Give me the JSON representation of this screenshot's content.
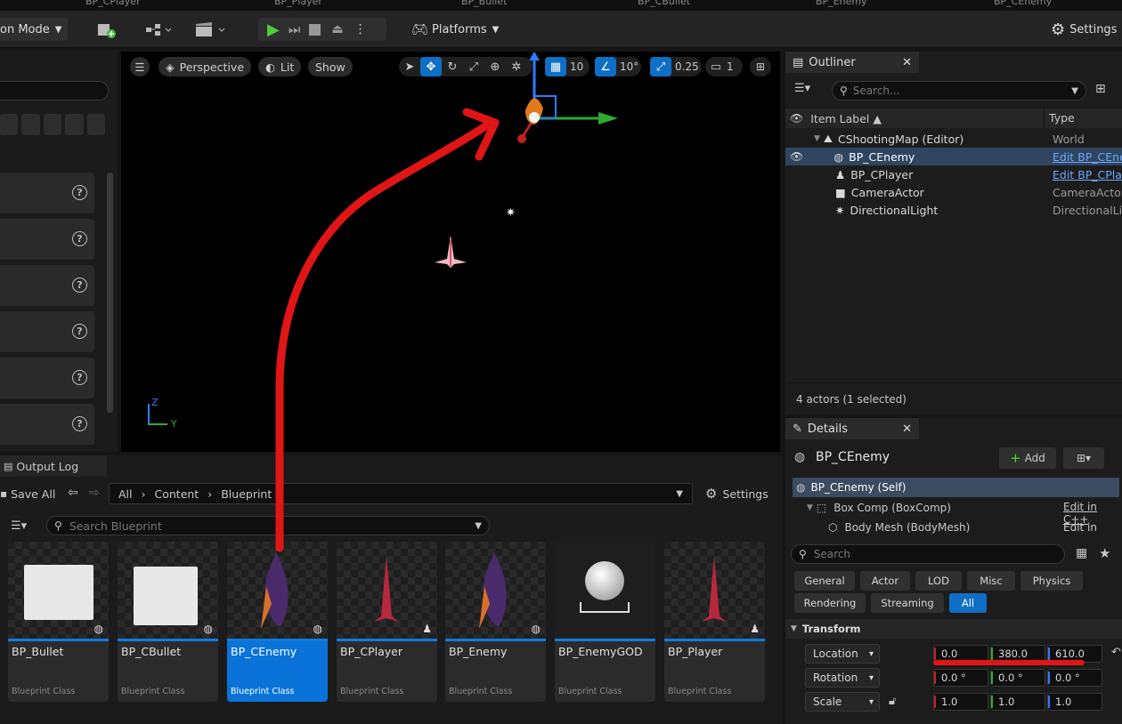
{
  "tabs": [
    "BP_CPlayer",
    "BP_Player",
    "BP_Bullet",
    "BP_CBullet",
    "BP_Enemy",
    "BP_CEnemy"
  ],
  "toolbar": {
    "mode_label": "on Mode",
    "platforms_label": "Platforms",
    "settings_label": "Settings"
  },
  "viewport": {
    "perspective_label": "Perspective",
    "lit_label": "Lit",
    "show_label": "Show",
    "grid_snap": "10",
    "rot_snap": "10°",
    "scale_snap": "0.25",
    "camera_speed": "1",
    "axis_z": "Z",
    "axis_y": "Y"
  },
  "outliner": {
    "title": "Outliner",
    "search_placeholder": "Search...",
    "col_label": "Item Label ▲",
    "col_type": "Type",
    "rows": [
      {
        "label": "CShootingMap (Editor)",
        "type": "World"
      },
      {
        "label": "BP_CEnemy",
        "type": "Edit BP_CEnemy"
      },
      {
        "label": "BP_CPlayer",
        "type": "Edit BP_CPlayer"
      },
      {
        "label": "CameraActor",
        "type": "CameraActor"
      },
      {
        "label": "DirectionalLight",
        "type": "DirectionalLight"
      }
    ],
    "status": "4 actors (1 selected)"
  },
  "details": {
    "title": "Details",
    "actor_name": "BP_CEnemy",
    "add_label": "Add",
    "components": [
      {
        "label": "BP_CEnemy (Self)",
        "action": ""
      },
      {
        "label": "Box Comp (BoxComp)",
        "action": "Edit in C++"
      },
      {
        "label": "Body Mesh (BodyMesh)",
        "action": "Edit in C++"
      }
    ],
    "search_placeholder": "Search",
    "filters_row1": [
      "General",
      "Actor",
      "LOD",
      "Misc",
      "Physics"
    ],
    "filters_row2": [
      "Rendering",
      "Streaming",
      "All"
    ],
    "section": "Transform",
    "location": {
      "label": "Location",
      "x": "0.0",
      "y": "380.0",
      "z": "610.0"
    },
    "rotation": {
      "label": "Rotation",
      "x": "0.0 °",
      "y": "0.0 °",
      "z": "0.0 °"
    },
    "scale": {
      "label": "Scale",
      "x": "1.0",
      "y": "1.0",
      "z": "1.0"
    }
  },
  "content_browser": {
    "output_log": "Output Log",
    "save_all": "Save All",
    "path": [
      "All",
      "Content",
      "Blueprint"
    ],
    "settings_label": "Settings",
    "search_placeholder": "Search Blueprint",
    "assets": [
      {
        "name": "BP_Bullet",
        "cls": "Blueprint Class"
      },
      {
        "name": "BP_CBullet",
        "cls": "Blueprint Class"
      },
      {
        "name": "BP_CEnemy",
        "cls": "Blueprint Class"
      },
      {
        "name": "BP_CPlayer",
        "cls": "Blueprint Class"
      },
      {
        "name": "BP_Enemy",
        "cls": "Blueprint Class"
      },
      {
        "name": "BP_EnemyGOD",
        "cls": "Blueprint Class"
      },
      {
        "name": "BP_Player",
        "cls": "Blueprint Class"
      }
    ]
  },
  "colors": {
    "accent": "#0f7be0",
    "annotation": "#e01515"
  }
}
